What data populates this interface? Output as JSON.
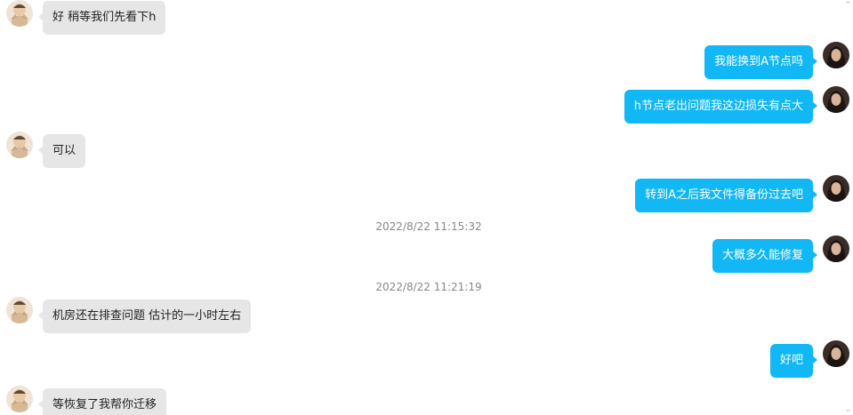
{
  "colors": {
    "incoming_bubble": "#e6e6e6",
    "outgoing_bubble": "#12b7f5",
    "timestamp_text": "#888888"
  },
  "messages": [
    {
      "side": "in",
      "text": "好 稍等我们先看下h"
    },
    {
      "side": "out",
      "text": "我能换到A节点吗"
    },
    {
      "side": "out",
      "text": "h节点老出问题我这边损失有点大"
    },
    {
      "side": "in",
      "text": "可以"
    },
    {
      "side": "out",
      "text": "转到A之后我文件得备份过去吧"
    },
    {
      "side": "time",
      "text": "2022/8/22 11:15:32"
    },
    {
      "side": "out",
      "text": "大概多久能修复"
    },
    {
      "side": "time",
      "text": "2022/8/22 11:21:19"
    },
    {
      "side": "in",
      "text": "机房还在排查问题 估计的一小时左右"
    },
    {
      "side": "out",
      "text": "好吧"
    },
    {
      "side": "in",
      "text": "等恢复了我帮你迁移"
    }
  ]
}
